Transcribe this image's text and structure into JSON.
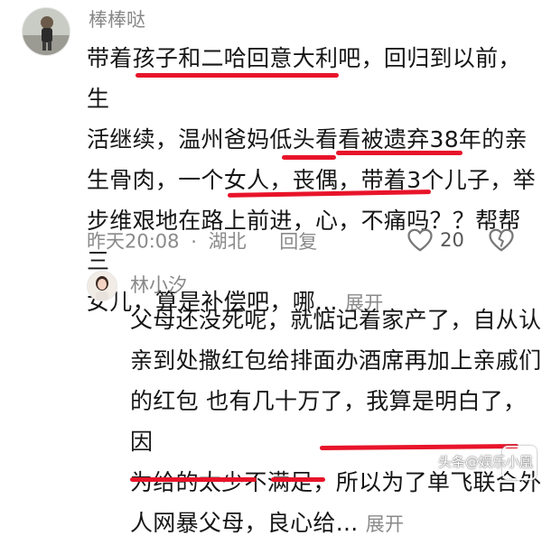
{
  "comment1": {
    "username": "棒棒哒",
    "lines": [
      "带着孩子和二哈回意大利吧，回归到以前，生",
      "活继续，温州爸妈低头看看被遗弃38年的亲",
      "生骨肉，一个女人，丧偶，带着3个儿子，举",
      "步维艰地在路上前进，心，不痛吗？？帮帮三",
      "女儿，算是补偿吧，哪..."
    ],
    "expand_label": "展开",
    "time": "昨天20:08",
    "separator": "·",
    "location": "湖北",
    "reply_label": "回复",
    "like_count": "20"
  },
  "reply1": {
    "username": "林小汐",
    "lines": [
      "父母还没死呢，就惦记着家产了，自从认",
      "亲到处撒红包给排面办酒席再加上亲戚们",
      "的红包 也有几十万了，我算是明白了，因",
      "为给的太少不满足，所以为了单飞联合外",
      "人网暴父母，良心给..."
    ],
    "expand_label": "展开"
  },
  "watermark": "头条@娱乐小凰",
  "colors": {
    "underline": "#e8142a",
    "meta": "#8a8a8a",
    "text": "#161616"
  }
}
